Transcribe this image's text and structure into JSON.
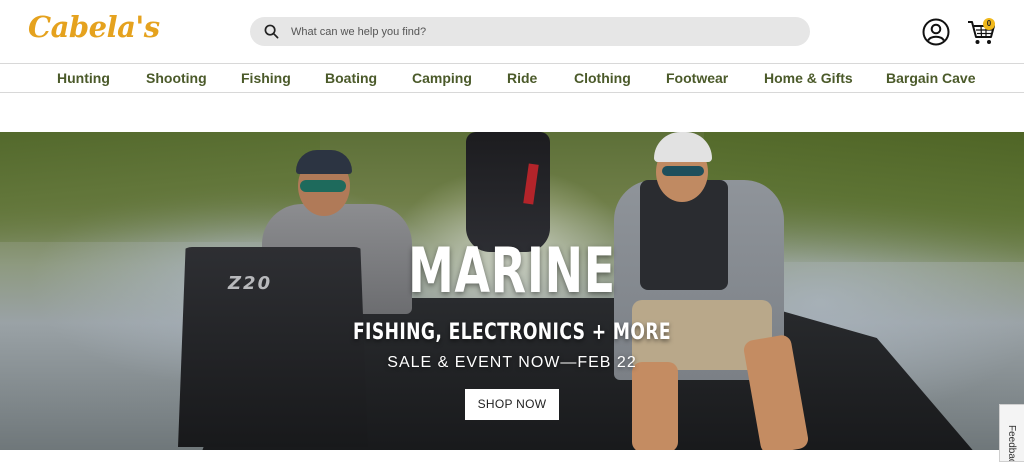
{
  "header": {
    "logo_text": "Cabela's",
    "search": {
      "placeholder": "What can we help you find?"
    },
    "account_icon": "account-icon",
    "cart": {
      "icon": "cart-icon",
      "count": "0"
    }
  },
  "nav": {
    "items": [
      {
        "label": "Hunting"
      },
      {
        "label": "Shooting"
      },
      {
        "label": "Fishing"
      },
      {
        "label": "Boating"
      },
      {
        "label": "Camping"
      },
      {
        "label": "Ride"
      },
      {
        "label": "Clothing"
      },
      {
        "label": "Footwear"
      },
      {
        "label": "Home & Gifts"
      },
      {
        "label": "Bargain Cave"
      }
    ]
  },
  "hero": {
    "title": "MARINE",
    "subtitle": "FISHING, ELECTRONICS + MORE",
    "tagline": "SALE & EVENT NOW—FEB 22",
    "cta_label": "SHOP NOW",
    "console_text": "Z20"
  },
  "feedback_tab": {
    "label": "Feedback"
  },
  "colors": {
    "brand_gold": "#e5a21e",
    "nav_text": "#4b5a2a",
    "search_bg": "#e6e6e6",
    "cart_badge": "#f0b81b"
  }
}
